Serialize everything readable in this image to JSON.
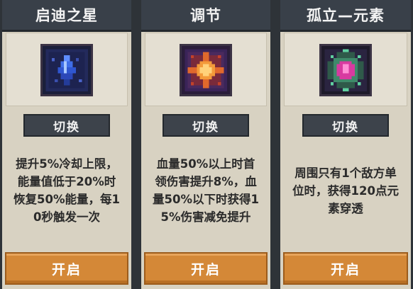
{
  "cards": [
    {
      "title": "启迪之星",
      "icon": "blue-crystal-icon",
      "switch_label": "切换",
      "description_lines": [
        "提升5%冷却上限，",
        "能量值低于20%时",
        "恢复50%能量，每1",
        "0秒触发一次"
      ],
      "open_label": "开启"
    },
    {
      "title": "调节",
      "icon": "orange-star-icon",
      "switch_label": "切换",
      "description_lines": [
        "血量50%以上时首",
        "领伤害提升8%，血",
        "量50%以下时获得1",
        "5%伤害减免提升"
      ],
      "open_label": "开启"
    },
    {
      "title": "孤立—元素",
      "icon": "green-pink-gem-icon",
      "switch_label": "切换",
      "description_lines": [
        "周围只有1个敌方单",
        "位时，获得120点元",
        "素穿透"
      ],
      "open_label": "开启"
    }
  ]
}
